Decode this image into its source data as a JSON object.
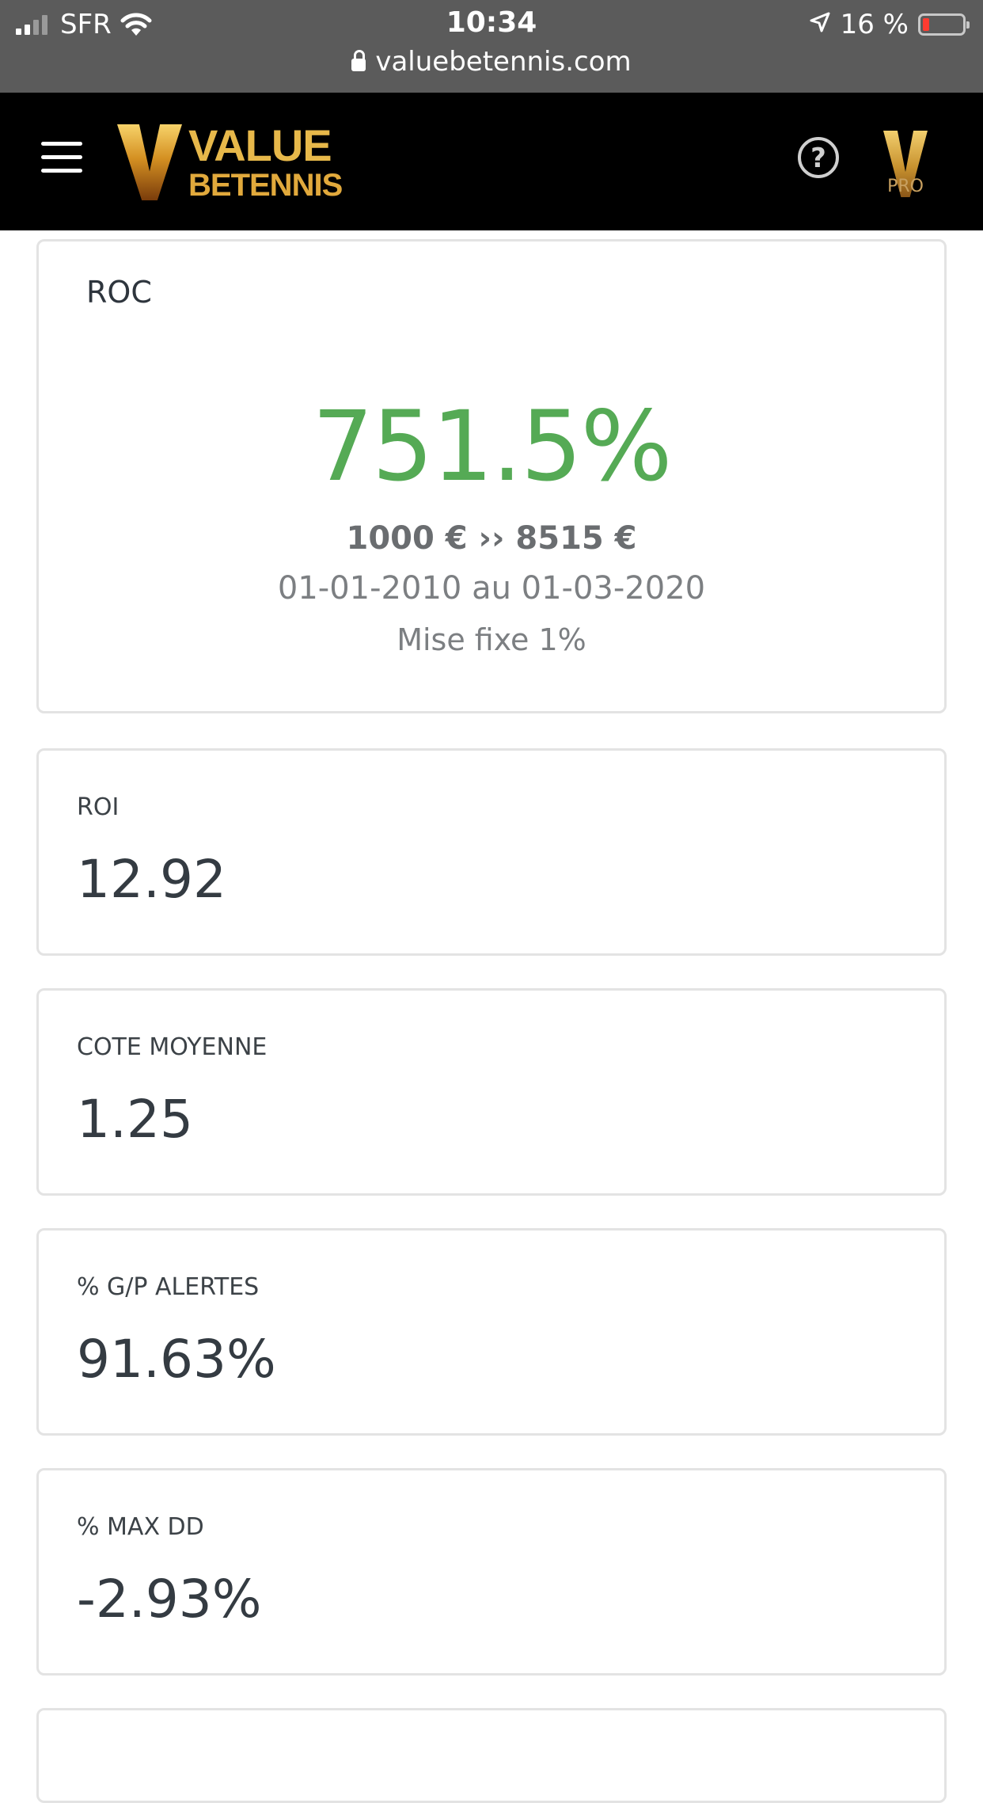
{
  "status_bar": {
    "carrier": "SFR",
    "time": "10:34",
    "battery": "16 %",
    "url": "valuebetennis.com"
  },
  "header": {
    "logo_line1": "VALUE",
    "logo_line2": "BETENNIS",
    "help_symbol": "?",
    "pro_label": "PRO",
    "icons": [
      "menu-icon",
      "help-icon",
      "pro-badge-icon"
    ]
  },
  "roc_card": {
    "title": "ROC",
    "value": "751.5%",
    "amounts": "1000 € ›› 8515 €",
    "period": "01-01-2010 au 01-03-2020",
    "stake": "Mise fixe 1%",
    "value_color": "#55aa55"
  },
  "stats": [
    {
      "label": "ROI",
      "value": "12.92"
    },
    {
      "label": "COTE MOYENNE",
      "value": "1.25"
    },
    {
      "label": "% G/P ALERTES",
      "value": "91.63%"
    },
    {
      "label": "% MAX DD",
      "value": "-2.93%"
    }
  ]
}
